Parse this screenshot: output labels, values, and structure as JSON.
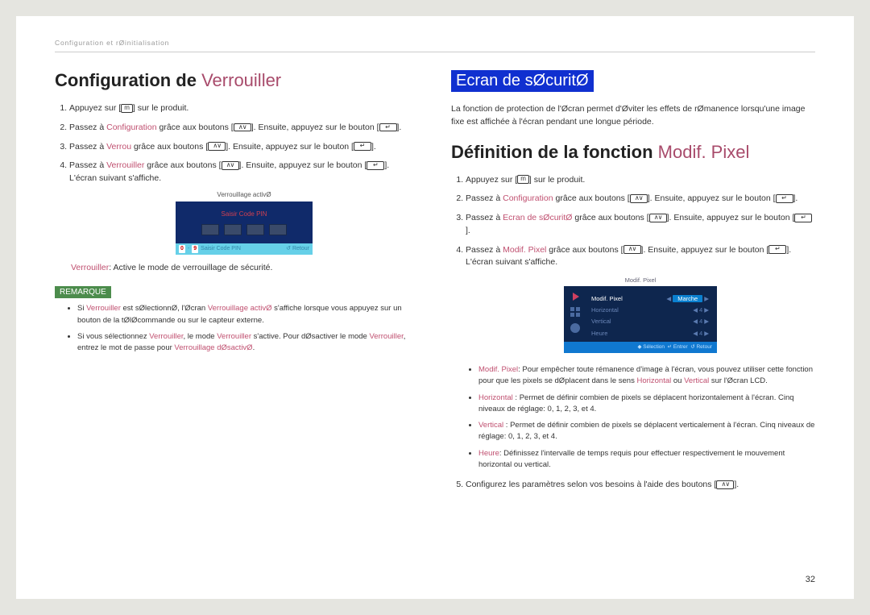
{
  "breadcrumb": "Configuration et rØinitialisation",
  "page_number": "32",
  "left": {
    "heading_main": "Configuration de ",
    "heading_accent": "Verrouiller",
    "steps": {
      "s1a": "Appuyez sur [",
      "s1b": "] sur le produit.",
      "s2a": "Passez à ",
      "s2kw": "Configuration",
      "s2b": " grâce aux boutons [",
      "s2c": "]. Ensuite, appuyez sur le bouton [",
      "s2d": "].",
      "s3a": "Passez à ",
      "s3kw": "Verrou",
      "s3b": " grâce aux boutons [",
      "s3c": "]. Ensuite, appuyez sur le bouton [",
      "s3d": "].",
      "s4a": "Passez à ",
      "s4kw": "Verrouiller",
      "s4b": " grâce aux boutons [",
      "s4c": "]. Ensuite, appuyez sur le bouton [",
      "s4d": "]. L'écran suivant s'affiche."
    },
    "pin": {
      "title": "Verrouillage activØ",
      "label": "Saisir Code PIN",
      "n0": "0",
      "n9": "9",
      "footer_a": "Saisir Code PIN",
      "footer_ret": "Retour"
    },
    "caption_kw": "Verrouiller",
    "caption_rest": ": Active le mode de verrouillage de sécurité.",
    "remark_badge": "REMARQUE",
    "remarks": {
      "r1a": "Si ",
      "r1kw1": "Verrouiller",
      "r1b": " est sØlectionnØ, l'Øcran ",
      "r1kw2": "Verrouillage activØ",
      "r1c": " s'affiche lorsque vous appuyez sur un bouton de la tØlØcommande ou sur le capteur externe.",
      "r2a": "Si vous sélectionnez ",
      "r2kw1": "Verrouiller",
      "r2b": ", le mode ",
      "r2kw2": "Verrouiller",
      "r2c": " s'active. Pour dØsactiver le mode ",
      "r2kw3": "Verrouiller",
      "r2d": ", entrez le mot de passe pour ",
      "r2kw4": "Verrouillage dØsactivØ"
    }
  },
  "right": {
    "heading_highlight": "Ecran de sØcuritØ",
    "intro": "La fonction de protection de l'Øcran permet d'Øviter les effets de rØmanence lorsqu'une image fixe est affichée à l'écran pendant une longue période.",
    "h2_main": "Définition de la fonction ",
    "h2_accent": "Modif. Pixel",
    "steps": {
      "s1a": "Appuyez sur [",
      "s1b": "] sur le produit.",
      "s2a": "Passez à ",
      "s2kw": "Configuration",
      "s2b": " grâce aux boutons [",
      "s2c": "]. Ensuite, appuyez sur le bouton [",
      "s2d": "].",
      "s3a": "Passez à ",
      "s3kw": "Ecran de sØcuritØ",
      "s3b": " grâce aux boutons [",
      "s3c": "]. Ensuite, appuyez sur le bouton [",
      "s3d": "].",
      "s4a": "Passez à ",
      "s4kw": "Modif. Pixel",
      "s4b": " grâce aux boutons [",
      "s4c": "]. Ensuite, appuyez sur le bouton [",
      "s4d": "]. L'écran suivant s'affiche."
    },
    "mp": {
      "title": "Modif. Pixel",
      "r1n": "Modif. Pixel",
      "r1v": "Marche",
      "r2n": "Horizontal",
      "r2v": "4",
      "r3n": "Vertical",
      "r3v": "4",
      "r4n": "Heure",
      "r4v": "4",
      "foot_sel": "Sélection",
      "foot_ent": "Entrer",
      "foot_ret": "Retour"
    },
    "bullets": {
      "b1kw": "Modif. Pixel",
      "b1": ": Pour empêcher toute rémanence d'image à l'écran, vous pouvez utiliser cette fonction pour que les pixels se dØplacent dans le sens ",
      "b1kw2": "Horizontal",
      "b1mid": " ou ",
      "b1kw3": "Vertical",
      "b1end": " sur l'Øcran LCD.",
      "b2kw": "Horizontal",
      "b2": " : Permet de définir combien de pixels se déplacent horizontalement à l'écran. Cinq niveaux de réglage: 0, 1, 2, 3, et 4.",
      "b3kw": "Vertical",
      "b3": " : Permet de définir combien de pixels se déplacent verticalement à l'écran. Cinq niveaux de réglage: 0, 1, 2, 3, et 4.",
      "b4kw": "Heure",
      "b4": ": Définissez l'intervalle de temps requis pour effectuer respectivement le mouvement horizontal ou vertical."
    },
    "step5": "Configurez les paramètres selon vos besoins à l'aide des boutons ["
  }
}
